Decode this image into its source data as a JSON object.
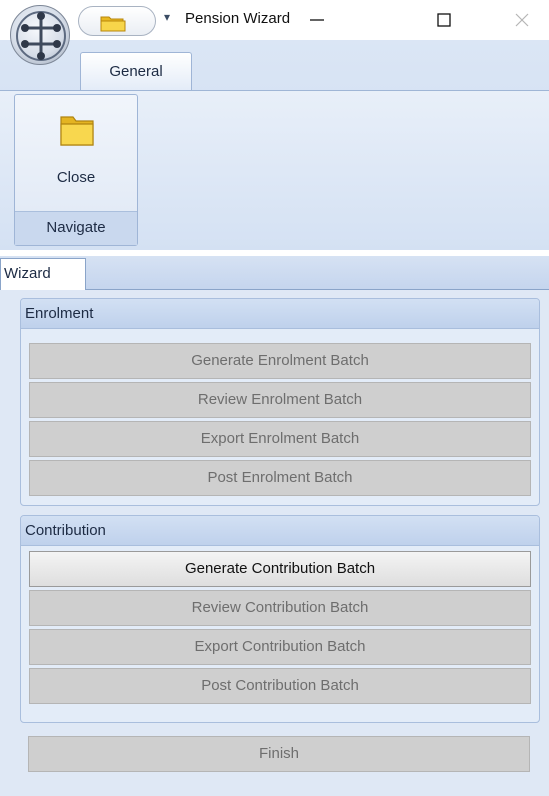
{
  "window": {
    "title": "Pension Wizard",
    "app_menu_icon": "app-orb-icon",
    "quick_access_icon": "folder-icon"
  },
  "ribbon": {
    "tabs": [
      {
        "label": "General"
      }
    ],
    "groups": [
      {
        "caption": "Navigate",
        "buttons": [
          {
            "label": "Close",
            "icon": "folder-icon"
          }
        ]
      }
    ]
  },
  "wizard": {
    "tab_label": "Wizard",
    "sections": [
      {
        "title": "Enrolment",
        "buttons": [
          {
            "label": "Generate Enrolment Batch",
            "enabled": false
          },
          {
            "label": "Review Enrolment Batch",
            "enabled": false
          },
          {
            "label": "Export Enrolment Batch",
            "enabled": false
          },
          {
            "label": "Post Enrolment Batch",
            "enabled": false
          }
        ]
      },
      {
        "title": "Contribution",
        "buttons": [
          {
            "label": "Generate Contribution Batch",
            "enabled": true
          },
          {
            "label": "Review Contribution Batch",
            "enabled": false
          },
          {
            "label": "Export Contribution Batch",
            "enabled": false
          },
          {
            "label": "Post Contribution Batch",
            "enabled": false
          }
        ]
      }
    ],
    "finish_label": "Finish",
    "finish_enabled": false
  },
  "colors": {
    "ribbon_bg": "#d4e1f3",
    "disabled_button": "#cfcfcf",
    "disabled_text": "#6e6e6e"
  }
}
